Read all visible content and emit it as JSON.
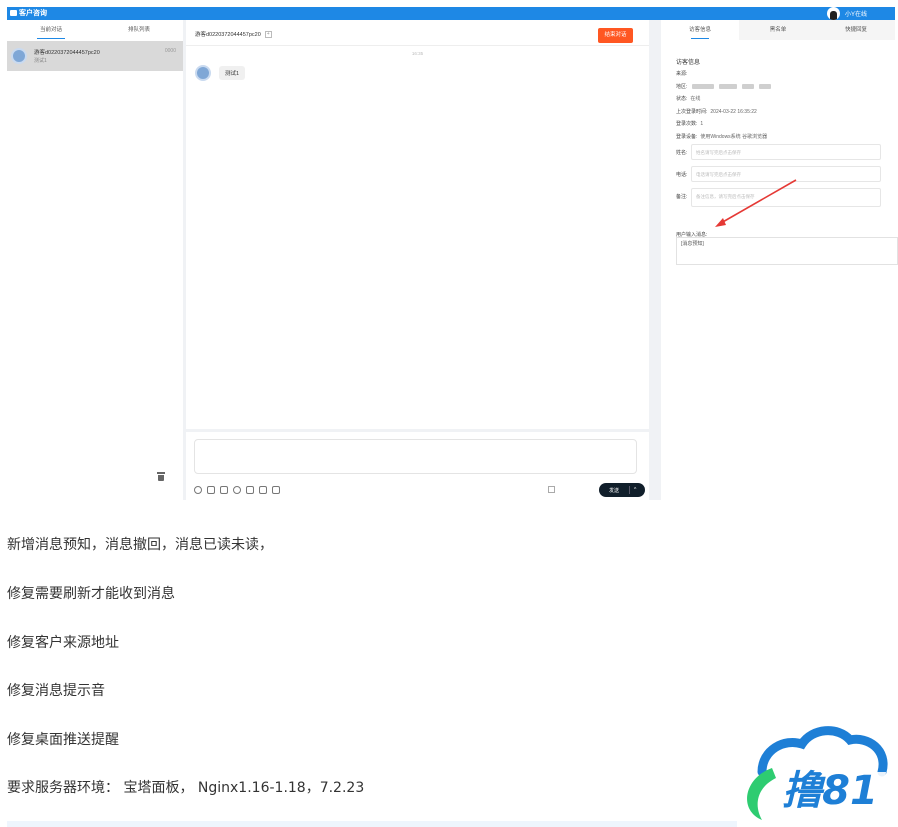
{
  "app": {
    "title": "客户咨询",
    "agent_name": "小Y在线"
  },
  "left_panel": {
    "tabs": [
      "当前对话",
      "排队列表"
    ],
    "conversation": {
      "name": "游客d0220372044457pc20",
      "preview": "测试1",
      "time": "0000"
    }
  },
  "chat": {
    "visitor_name": "游客d0220372044457pc20",
    "plus_label": "+",
    "end_button": "结束对话",
    "timestamp": "16:35",
    "message": "测试1",
    "send_label": "发送",
    "send_caret": "^"
  },
  "right_panel": {
    "tabs": [
      "访客信息",
      "黑名单",
      "快捷回复"
    ],
    "section_title": "访客信息",
    "info": [
      {
        "key": "来源:",
        "value": ""
      },
      {
        "key": "地区:",
        "value": ""
      },
      {
        "key": "状态:",
        "value": "在线"
      },
      {
        "key": "上次登录时间:",
        "value": "2024-03-22 16:35:22"
      },
      {
        "key": "登录次数:",
        "value": "1"
      },
      {
        "key": "登录设备:",
        "value": "使用Windows系统 谷歌浏览器"
      }
    ],
    "fields": [
      {
        "label": "姓名:",
        "placeholder": "姓名请写完后点击保存"
      },
      {
        "label": "电话:",
        "placeholder": "电话请写完后点击保存"
      },
      {
        "label": "备注:",
        "placeholder": "备注信息，请写完后点击保存"
      }
    ],
    "user_input_label": "用户输入消息:",
    "user_input_value": "[消息预知]",
    "arrow_color": "#e53935"
  },
  "notes": [
    "新增消息预知，消息撤回，消息已读未读，",
    "修复需要刷新才能收到消息",
    "修复客户来源地址",
    "修复消息提示音",
    "修复桌面推送提醒",
    "要求服务器环境： 宝塔面板， Nginx1.16-1.18，7.2.23"
  ],
  "watermark": {
    "text": "撸81",
    "colors": {
      "cloud": "#1e7fd6",
      "swoosh": "#2ecc71"
    }
  },
  "colors": {
    "topbar": "#1e88e5",
    "end_button": "#ff5722",
    "send_button": "#111f2b"
  }
}
